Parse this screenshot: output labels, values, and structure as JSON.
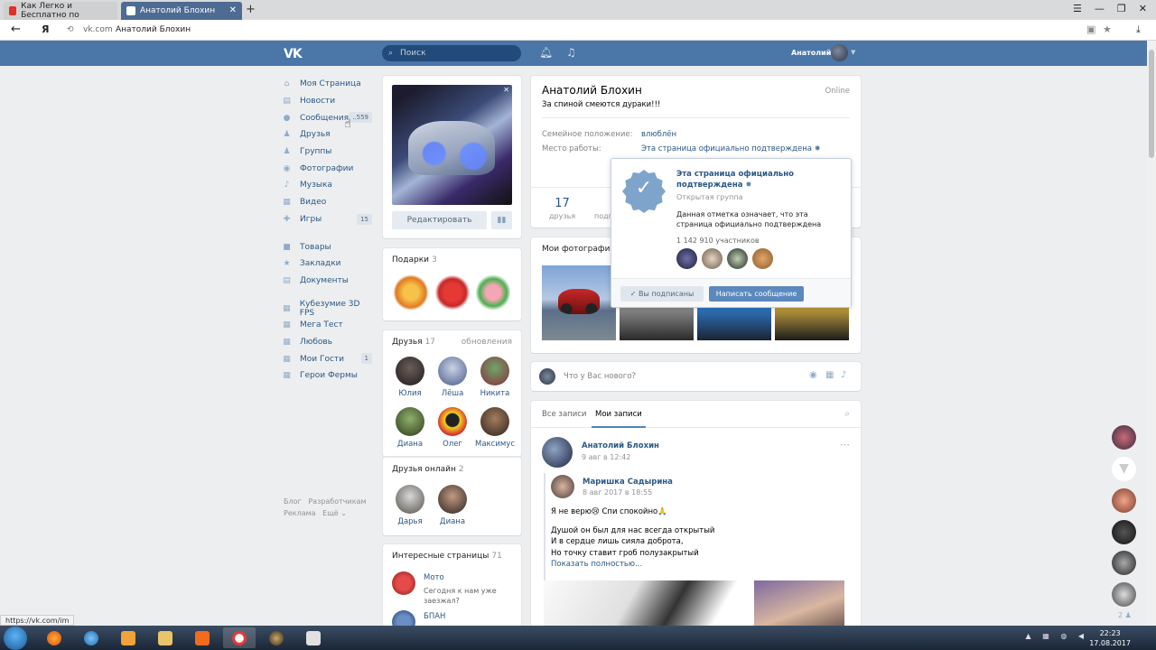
{
  "browser": {
    "tabs": [
      {
        "title": "Как Легко и Бесплатно по"
      },
      {
        "title": "Анатолий Блохин"
      }
    ],
    "host": "vk.com",
    "page_title": "Анатолий Блохин",
    "search_engine_letter": "Я",
    "status_url": "https://vk.com/im"
  },
  "header": {
    "logo": "VK",
    "search_placeholder": "Поиск",
    "user_name": "Анатолий"
  },
  "menu": {
    "main": [
      {
        "label": "Моя Страница",
        "icon": "home-icon"
      },
      {
        "label": "Новости",
        "icon": "news-icon"
      },
      {
        "label": "Сообщения",
        "icon": "messages-icon",
        "count": "..559"
      },
      {
        "label": "Друзья",
        "icon": "friends-icon"
      },
      {
        "label": "Группы",
        "icon": "groups-icon"
      },
      {
        "label": "Фотографии",
        "icon": "camera-icon"
      },
      {
        "label": "Музыка",
        "icon": "music-icon"
      },
      {
        "label": "Видео",
        "icon": "video-icon"
      },
      {
        "label": "Игры",
        "icon": "games-icon",
        "count": "15"
      }
    ],
    "second": [
      {
        "label": "Товары"
      },
      {
        "label": "Закладки"
      },
      {
        "label": "Документы"
      }
    ],
    "apps": [
      {
        "label": "Кубезумие 3D FPS"
      },
      {
        "label": "Мега Тест"
      },
      {
        "label": "Любовь"
      },
      {
        "label": "Мои Гости",
        "count": "1"
      },
      {
        "label": "Герои Фермы"
      }
    ],
    "footer": {
      "blog": "Блог",
      "dev": "Разработчикам",
      "ads": "Реклама",
      "more": "Ещё"
    }
  },
  "left_col": {
    "edit_button": "Редактировать",
    "gifts": {
      "title": "Подарки",
      "count": "3"
    },
    "friends": {
      "title": "Друзья",
      "count": "17",
      "updates": "обновления",
      "items": [
        "Юлия",
        "Лёша",
        "Никита",
        "Диана",
        "Олег",
        "Максимус"
      ]
    },
    "online": {
      "title": "Друзья онлайн",
      "count": "2",
      "items": [
        "Дарья",
        "Диана"
      ]
    },
    "interesting": {
      "title": "Интересные страницы",
      "count": "71",
      "items": [
        {
          "name": "Мото",
          "desc": "Сегодня к нам уже заезжал?"
        },
        {
          "name": "БПАН",
          "desc": ""
        }
      ]
    }
  },
  "profile": {
    "name": "Анатолий Блохин",
    "status": "За спиной смеются дураки!!!",
    "online": "Online",
    "family_key": "Семейное положение:",
    "family_val": "влюблён",
    "work_key": "Место работы:",
    "work_val": "Эта страница официально подтверждена",
    "friends_count": "17",
    "friends_label": "друзья",
    "subs_label_partial": "подп"
  },
  "photos": {
    "title": "Мои фотографии"
  },
  "popup": {
    "title": "Эта страница официально подтверждена",
    "type": "Открытая группа",
    "desc": "Данная отметка означает, что эта страница официально подтверждена",
    "members": "1 142 910 участников",
    "subscribed": "Вы подписаны",
    "message": "Написать сообщение"
  },
  "composer": {
    "placeholder": "Что у Вас нового?"
  },
  "wall": {
    "tab_all": "Все записи",
    "tab_mine": "Мои записи",
    "author": "Анатолий Блохин",
    "date": "9 авг в 12:42",
    "repost_author": "Маришка Садырина",
    "repost_date": "8 авг 2017 в 18:55",
    "line1": "Я не верю😢 Спи спокойно🙏",
    "line2": "Душой он был для нас всегда открытый",
    "line3": "И в сердце лишь сияла доброта,",
    "line4": "Но точку ставит гроб полузакрытый",
    "more": "Показать полностью..."
  },
  "right_panel": {
    "count": "2"
  },
  "taskbar": {
    "time": "22:23",
    "date": "17.08.2017"
  }
}
